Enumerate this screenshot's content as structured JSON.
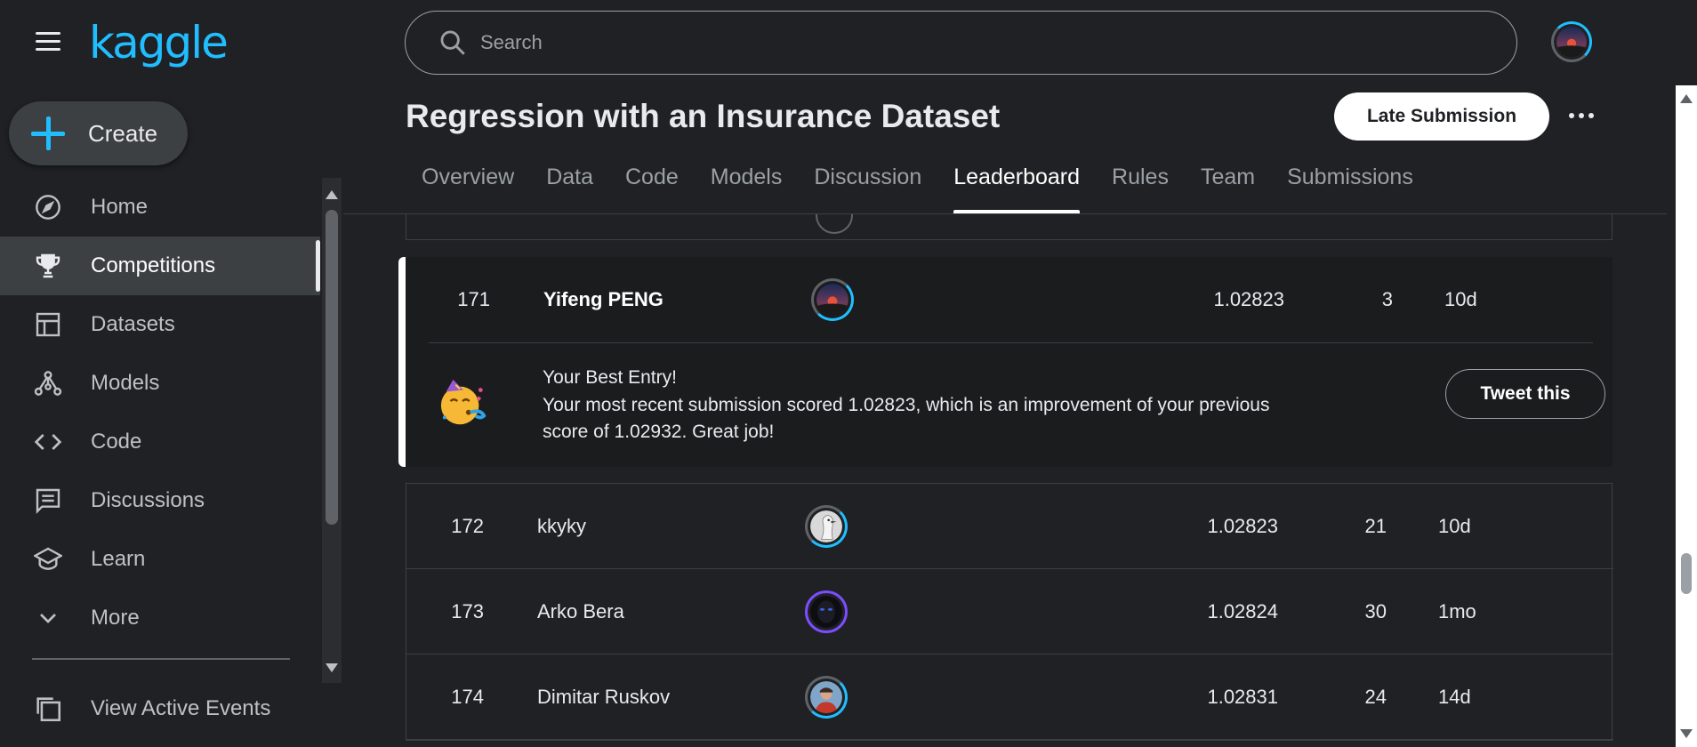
{
  "app": {
    "logo": "kaggle"
  },
  "sidebar": {
    "create_label": "Create",
    "items": [
      {
        "label": "Home",
        "icon": "compass-icon"
      },
      {
        "label": "Competitions",
        "icon": "trophy-icon",
        "active": true
      },
      {
        "label": "Datasets",
        "icon": "table-icon"
      },
      {
        "label": "Models",
        "icon": "models-icon"
      },
      {
        "label": "Code",
        "icon": "code-icon"
      },
      {
        "label": "Discussions",
        "icon": "comment-icon"
      },
      {
        "label": "Learn",
        "icon": "school-icon"
      },
      {
        "label": "More",
        "icon": "chevron-down-icon"
      }
    ],
    "view_events_label": "View Active Events"
  },
  "search": {
    "placeholder": "Search"
  },
  "competition": {
    "title": "Regression with an Insurance Dataset",
    "late_submission_label": "Late Submission"
  },
  "tabs": [
    "Overview",
    "Data",
    "Code",
    "Models",
    "Discussion",
    "Leaderboard",
    "Rules",
    "Team",
    "Submissions"
  ],
  "active_tab": "Leaderboard",
  "best_entry": {
    "rank": "171",
    "name": "Yifeng PENG",
    "score": "1.02823",
    "entries": "3",
    "last": "10d",
    "title": "Your Best Entry!",
    "message": "Your most recent submission scored 1.02823, which is an improvement of your previous score of 1.02932. Great job!",
    "tweet_label": "Tweet this"
  },
  "leaderboard_rows": [
    {
      "rank": "172",
      "name": "kkyky",
      "score": "1.02823",
      "entries": "21",
      "last": "10d"
    },
    {
      "rank": "173",
      "name": "Arko Bera",
      "score": "1.02824",
      "entries": "30",
      "last": "1mo"
    },
    {
      "rank": "174",
      "name": "Dimitar Ruskov",
      "score": "1.02831",
      "entries": "24",
      "last": "14d"
    }
  ],
  "colors": {
    "accent": "#20beff",
    "background": "#202124"
  }
}
